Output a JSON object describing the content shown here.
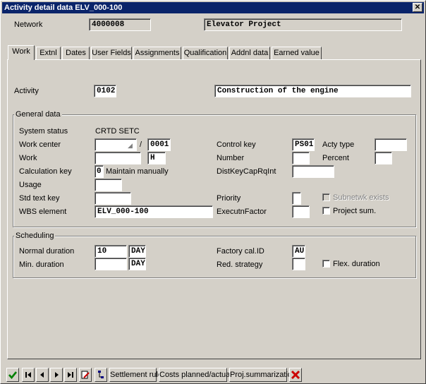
{
  "window": {
    "title": "Activity detail data  ELV_000-100",
    "close_icon": "close-icon"
  },
  "header": {
    "network_label": "Network",
    "network_value": "4000008",
    "network_description": "Elevator Project"
  },
  "tabs": [
    {
      "label": "Work",
      "active": true
    },
    {
      "label": "Extnl"
    },
    {
      "label": "Dates"
    },
    {
      "label": "User Fields"
    },
    {
      "label": "Assignments"
    },
    {
      "label": "Qualification"
    },
    {
      "label": "Addnl data"
    },
    {
      "label": "Earned value"
    }
  ],
  "activity": {
    "label": "Activity",
    "number": "0102",
    "description": "Construction of the engine"
  },
  "general": {
    "title": "General data",
    "system_status_label": "System status",
    "system_status_value": "CRTD SETC",
    "work_center_label": "Work center",
    "work_center_value": "",
    "separator": "/",
    "plant_value": "0001",
    "work_label": "Work",
    "work_value": "",
    "work_unit": "H",
    "calc_key_label": "Calculation key",
    "calc_key_value": "0",
    "calc_key_text": "Maintain manually",
    "usage_label": "Usage",
    "usage_value": "",
    "std_text_label": "Std text key",
    "std_text_value": "",
    "wbs_label": "WBS element",
    "wbs_value": "ELV_000-100",
    "control_key_label": "Control key",
    "control_key_value": "PS01",
    "acty_type_label": "Acty type",
    "acty_type_value": "",
    "number_label": "Number",
    "number_value": "",
    "percent_label": "Percent",
    "percent_value": "",
    "distkey_label": "DistKeyCapRqInt",
    "distkey_value": "",
    "priority_label": "Priority",
    "priority_value": "",
    "subnetwk_label": "Subnetwk exists",
    "execution_label": "ExecutnFactor",
    "execution_value": "",
    "project_sum_label": "Project sum."
  },
  "scheduling": {
    "title": "Scheduling",
    "normal_duration_label": "Normal duration",
    "normal_duration_value": "10",
    "normal_duration_unit": "DAY",
    "min_duration_label": "Min. duration",
    "min_duration_value": "",
    "min_duration_unit": "DAY",
    "factory_cal_label": "Factory cal.ID",
    "factory_cal_value": "AU",
    "red_strategy_label": "Red. strategy",
    "red_strategy_value": "",
    "flex_label": "Flex. duration"
  },
  "toolbar": {
    "settlement_rule": "Settlement rule",
    "costs_planned_actual": "Costs planned/actual",
    "proj_summarization": "Proj.summarization",
    "check_color": "#008000",
    "cancel_color": "#cc0000"
  }
}
